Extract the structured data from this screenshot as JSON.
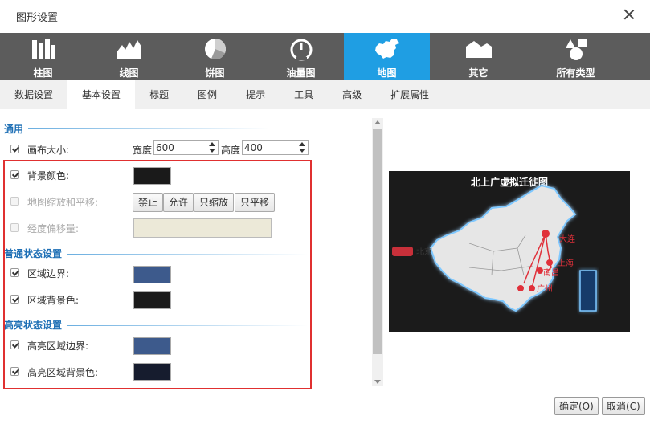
{
  "dialog": {
    "title": "图形设置"
  },
  "chart_types": [
    {
      "label": "柱图",
      "icon": "bar-chart-icon",
      "active": false
    },
    {
      "label": "线图",
      "icon": "line-chart-icon",
      "active": false
    },
    {
      "label": "饼图",
      "icon": "pie-chart-icon",
      "active": false
    },
    {
      "label": "油量图",
      "icon": "gauge-icon",
      "active": false
    },
    {
      "label": "地图",
      "icon": "china-map-icon",
      "active": true
    },
    {
      "label": "其它",
      "icon": "area-shape-icon",
      "active": false
    },
    {
      "label": "所有类型",
      "icon": "all-types-icon",
      "active": false
    }
  ],
  "tabs": [
    {
      "label": "数据设置",
      "active": false
    },
    {
      "label": "基本设置",
      "active": true
    },
    {
      "label": "标题",
      "active": false
    },
    {
      "label": "图例",
      "active": false
    },
    {
      "label": "提示",
      "active": false
    },
    {
      "label": "工具",
      "active": false
    },
    {
      "label": "高级",
      "active": false
    },
    {
      "label": "扩展属性",
      "active": false
    }
  ],
  "general": {
    "section": "通用",
    "canvas_label": "画布大小:",
    "width_label": "宽度",
    "width_value": "600",
    "height_label": "高度",
    "height_value": "400",
    "bg_color_label": "背景颜色:",
    "bg_color": "#1a1a1a",
    "zoom_label": "地图缩放和平移:",
    "zoom_buttons": [
      "禁止",
      "允许",
      "只缩放",
      "只平移"
    ],
    "offset_label": "经度偏移量:"
  },
  "normal": {
    "section": "普通状态设置",
    "border_label": "区域边界:",
    "border_color": "#3d5a8c",
    "bg_label": "区域背景色:",
    "bg_color": "#1a1a1a"
  },
  "highlight": {
    "section": "高亮状态设置",
    "border_label": "高亮区域边界:",
    "border_color": "#3d5a8c",
    "bg_label": "高亮区域背景色:",
    "bg_color": "#161c2e"
  },
  "preview": {
    "title": "北上广虚拟迁徙图",
    "legend_label": "北京",
    "cities": [
      "大连",
      "上海",
      "南昌",
      "广州"
    ]
  },
  "footer": {
    "ok": "确定(O)",
    "cancel": "取消(C)"
  },
  "colors": {
    "accent": "#1f9ee3",
    "toolbar": "#5c5c5c",
    "highlight_frame": "#e03030",
    "map_route": "#e0303a"
  }
}
